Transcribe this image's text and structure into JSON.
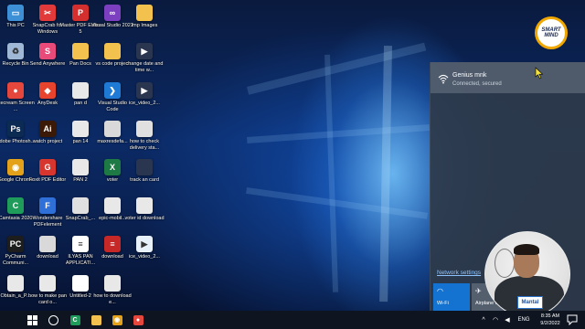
{
  "desktop": {
    "icons": [
      {
        "label": "This PC",
        "icon": "computer-icon",
        "color": "#3d8fd6"
      },
      {
        "label": "SnapCrab for Windows",
        "icon": "snapcrab-icon",
        "color": "#e23a3a"
      },
      {
        "label": "Master PDF Editor 5",
        "icon": "pdf-editor-icon",
        "color": "#d32f2f"
      },
      {
        "label": "Visual Studio 2022",
        "icon": "visual-studio-icon",
        "color": "#7b3fbf"
      },
      {
        "label": "Imp Images",
        "icon": "folder-icon",
        "color": "#f2c14e"
      },
      {
        "label": "Recycle Bin",
        "icon": "recycle-bin-icon",
        "color": "#9fb8d6"
      },
      {
        "label": "Send Anywhere",
        "icon": "send-anywhere-icon",
        "color": "#e84a7a"
      },
      {
        "label": "Pan Docs",
        "icon": "folder-icon",
        "color": "#f2c14e"
      },
      {
        "label": "vs code project",
        "icon": "folder-icon",
        "color": "#f2c14e"
      },
      {
        "label": "change date and time w...",
        "icon": "video-file-icon",
        "color": "#2a3550"
      },
      {
        "label": "Icecream Screen ...",
        "icon": "icecream-icon",
        "color": "#e6473d"
      },
      {
        "label": "AnyDesk",
        "icon": "anydesk-icon",
        "color": "#e8432d"
      },
      {
        "label": "pan d",
        "icon": "image-file-icon",
        "color": "#e8e8e8"
      },
      {
        "label": "Visual Studio Code",
        "icon": "vscode-icon",
        "color": "#1f7ad6"
      },
      {
        "label": "ice_video_2...",
        "icon": "video-file-icon",
        "color": "#2a3550"
      },
      {
        "label": "Adobe Photosh...",
        "icon": "photoshop-icon",
        "color": "#0b2b52"
      },
      {
        "label": "watch project",
        "icon": "illustrator-icon",
        "color": "#3a1a06"
      },
      {
        "label": "pan 14",
        "icon": "image-file-icon",
        "color": "#e8e8e8"
      },
      {
        "label": "maxresdefa...",
        "icon": "image-file-icon",
        "color": "#d9d9d9"
      },
      {
        "label": "how to check delivery sta...",
        "icon": "image-file-icon",
        "color": "#e0e0e0"
      },
      {
        "label": "Google Chrome",
        "icon": "chrome-icon",
        "color": "#e3a21a"
      },
      {
        "label": "Foxit PDF Editor",
        "icon": "foxit-icon",
        "color": "#d7362f"
      },
      {
        "label": "PAN 2",
        "icon": "image-file-icon",
        "color": "#e8e8e8"
      },
      {
        "label": "voter",
        "icon": "excel-icon",
        "color": "#1d7a44"
      },
      {
        "label": "track an card",
        "icon": "image-file-icon",
        "color": "#2a3550"
      },
      {
        "label": "Camtasia 2020",
        "icon": "camtasia-icon",
        "color": "#1f9b5a"
      },
      {
        "label": "Wondershare PDFelement",
        "icon": "pdfelement-icon",
        "color": "#2f6fd8"
      },
      {
        "label": "SnapCrab_...",
        "icon": "image-file-icon",
        "color": "#e0e0e0"
      },
      {
        "label": "epic-mobil...",
        "icon": "image-file-icon",
        "color": "#e8e8e8"
      },
      {
        "label": "voter id download",
        "icon": "image-file-icon",
        "color": "#e8e8e8"
      },
      {
        "label": "PyCharm Communi...",
        "icon": "pycharm-icon",
        "color": "#1d1d1d"
      },
      {
        "label": "download",
        "icon": "image-file-icon",
        "color": "#d9d9d9"
      },
      {
        "label": "ILYAS PAN APPLICATI...",
        "icon": "pdf-file-icon",
        "color": "#ffffff"
      },
      {
        "label": "download",
        "icon": "pdf-file-icon",
        "color": "#c62828"
      },
      {
        "label": "ice_video_2...",
        "icon": "video-file-icon",
        "color": "#e8f0fa"
      },
      {
        "label": "Obtain_a_P...",
        "icon": "image-file-icon",
        "color": "#e8e8e8"
      },
      {
        "label": "how to make pan card o...",
        "icon": "image-file-icon",
        "color": "#e8e8e8"
      },
      {
        "label": "Untitled-2",
        "icon": "image-file-icon",
        "color": "#ffffff"
      },
      {
        "label": "how to download e...",
        "icon": "image-file-icon",
        "color": "#e8e8e8"
      }
    ]
  },
  "network_flyout": {
    "network_name": "Genius mnk",
    "network_status": "Connected, secured",
    "settings_link": "Network settings",
    "tiles": [
      {
        "label": "Wi-Fi",
        "icon": "wifi-icon"
      },
      {
        "label": "Airplane mo",
        "icon": "airplane-icon"
      }
    ]
  },
  "logo": {
    "line1": "SMART",
    "line2": "MIND"
  },
  "webcam": {
    "badge": "Mantal"
  },
  "taskbar": {
    "start_icon": "windows-start-icon",
    "apps": [
      {
        "icon": "search-circle-icon",
        "color": "#ffffff"
      },
      {
        "icon": "camtasia-icon",
        "color": "#1f9b5a"
      },
      {
        "icon": "file-explorer-icon",
        "color": "#f2c14e"
      },
      {
        "icon": "chrome-icon",
        "color": "#e3a21a"
      },
      {
        "icon": "icecream-icon",
        "color": "#e6473d"
      }
    ],
    "tray": {
      "language": "ENG",
      "time": "8:35 AM",
      "date": "9/2/2022"
    }
  },
  "colors": {
    "accent": "#1473d0",
    "flyout_bg": "#2e3a4a",
    "taskbar_bg": "#0e1520",
    "link": "#8cc3ff"
  }
}
